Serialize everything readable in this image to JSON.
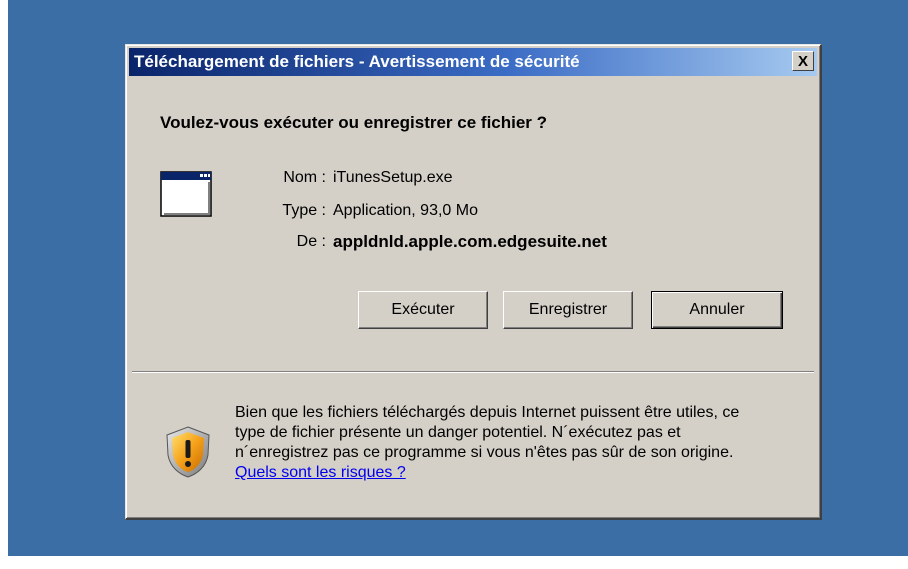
{
  "dialog": {
    "title": "Téléchargement de fichiers - Avertissement de sécurité",
    "close_label": "X",
    "question": "Voulez-vous exécuter ou enregistrer ce fichier ?"
  },
  "file": {
    "name_label": "Nom :",
    "name": "iTunesSetup.exe",
    "type_label": "Type :",
    "type": "Application, 93,0 Mo",
    "from_label": "De :",
    "from": "appldnld.apple.com.edgesuite.net"
  },
  "buttons": {
    "run": "Exécuter",
    "save": "Enregistrer",
    "cancel": "Annuler"
  },
  "warning": {
    "line1": "Bien que les fichiers téléchargés depuis Internet puissent être utiles, ce",
    "line2": "type de fichier présente un danger potentiel. N´exécutez pas et",
    "line3": "n´enregistrez pas ce programme si vous n'êtes pas sûr de son origine.",
    "link": "Quels sont les risques ?"
  },
  "icons": {
    "app": "application-window-icon",
    "warning": "security-shield-icon"
  }
}
